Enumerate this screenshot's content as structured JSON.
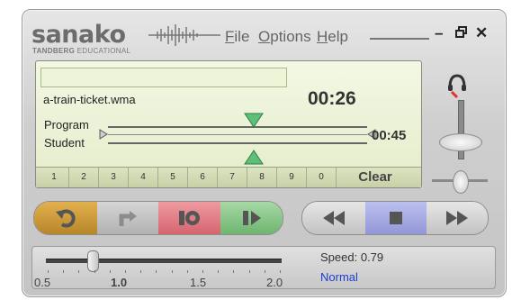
{
  "brand": {
    "name": "sanako",
    "sub_bold": "TANDBERG",
    "sub_rest": " EDUCATIONAL"
  },
  "menu": [
    {
      "accel": "F",
      "rest": "ile"
    },
    {
      "accel": "O",
      "rest": "ptions"
    },
    {
      "accel": "H",
      "rest": "elp"
    }
  ],
  "window_controls": {
    "minimize": "–",
    "restore": "🗗",
    "close": "✕"
  },
  "display": {
    "entry_value": "",
    "filename": "a-train-ticket.wma",
    "elapsed": "00:26",
    "track_labels": [
      "Program",
      "Student"
    ],
    "total": "00:45"
  },
  "keypad": [
    "1",
    "2",
    "3",
    "4",
    "5",
    "6",
    "7",
    "8",
    "9",
    "0"
  ],
  "keypad_clear": "Clear",
  "transport": {
    "left_group": [
      {
        "name": "repeat-button",
        "icon": "undo-arrow-icon",
        "color": "#c9962c"
      },
      {
        "name": "return-button",
        "icon": "return-arrow-icon",
        "color": "#bdbdbd"
      },
      {
        "name": "record-button",
        "icon": "record-icon",
        "color": "#e07a82"
      },
      {
        "name": "play-button",
        "icon": "play-icon",
        "color": "#86c488"
      }
    ],
    "right_group": [
      {
        "name": "rewind-button",
        "icon": "rewind-icon",
        "color": "#d4d4d4"
      },
      {
        "name": "stop-button",
        "icon": "stop-icon",
        "color": "#a9addf"
      },
      {
        "name": "forward-button",
        "icon": "fast-forward-icon",
        "color": "#d4d4d4"
      }
    ]
  },
  "speed": {
    "label": "Speed: 0.79",
    "value": 0.79,
    "min": 0.5,
    "max": 2.0,
    "scale_labels": [
      "0.5",
      "1.0",
      "1.5",
      "2.0"
    ],
    "normal_link": "Normal"
  },
  "colors": {
    "display_bg": "#eaf1d3",
    "link": "#1a3fd8",
    "green_marker": "#5fbf76"
  }
}
